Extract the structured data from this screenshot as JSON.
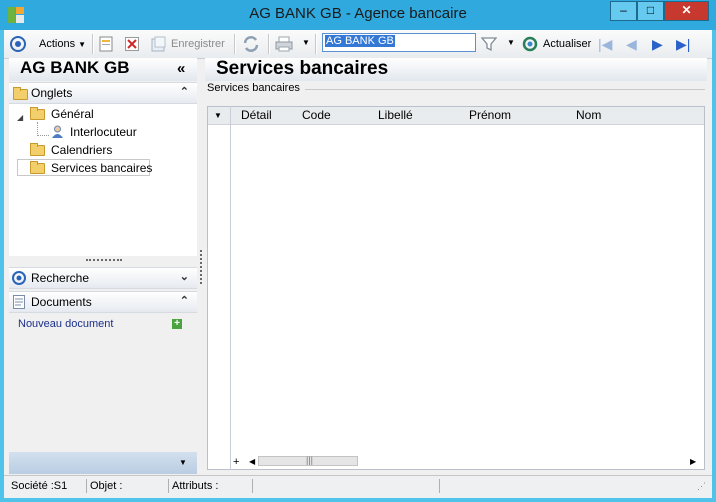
{
  "window": {
    "title": "AG BANK GB -  Agence bancaire",
    "controls": {
      "minimize": "–",
      "maximize": "□",
      "close": "✕"
    }
  },
  "toolbar": {
    "actions_label": "Actions",
    "save_label": "Enregistrer",
    "search_value": "AG BANK GB",
    "refresh_label": "Actualiser"
  },
  "left": {
    "title": "AG BANK GB",
    "collapse_glyph": "«",
    "onglets": {
      "label": "Onglets",
      "items": [
        {
          "label": "Général"
        },
        {
          "label": "Interlocuteur"
        },
        {
          "label": "Calendriers"
        },
        {
          "label": "Services bancaires"
        }
      ]
    },
    "recherche": {
      "label": "Recherche"
    },
    "documents": {
      "label": "Documents",
      "new_doc": "Nouveau document"
    }
  },
  "main": {
    "title": "Services bancaires",
    "section_label": "Services bancaires",
    "columns": [
      "Détail",
      "Code",
      "Libellé",
      "Prénom",
      "Nom"
    ]
  },
  "status": {
    "societe": "Société :S1",
    "objet": "Objet :",
    "attributs": "Attributs :"
  },
  "colors": {
    "titlebar": "#2fa9de",
    "close": "#c7382f",
    "accent": "#3478d6"
  }
}
